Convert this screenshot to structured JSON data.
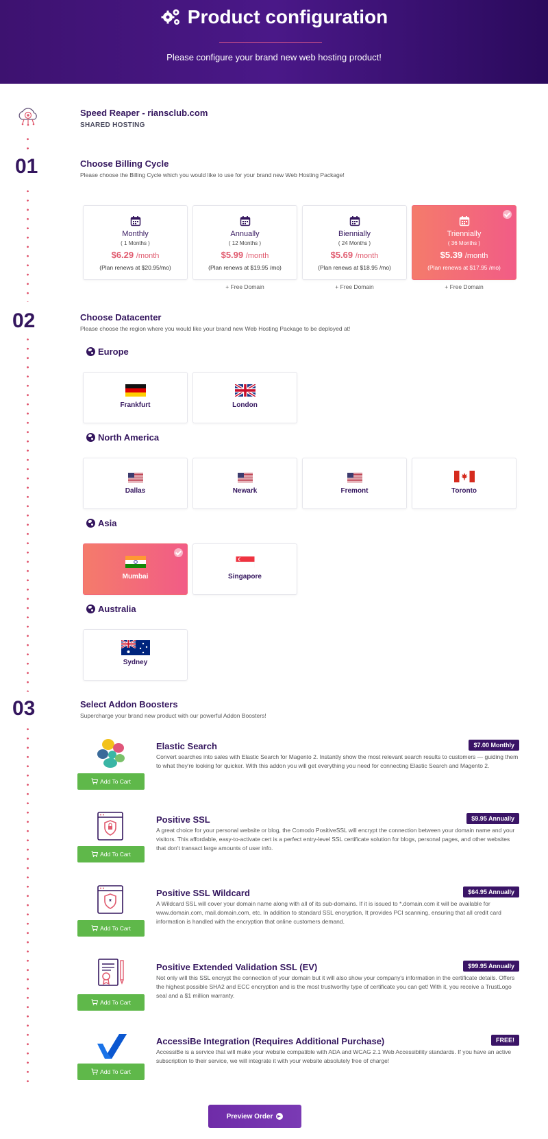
{
  "header": {
    "title": "Product configuration",
    "subtitle": "Please configure your brand new web hosting product!"
  },
  "product": {
    "name": "Speed Reaper - riansclub.com",
    "type": "SHARED HOSTING"
  },
  "steps": {
    "billing": {
      "number": "01",
      "title": "Choose Billing Cycle",
      "description": "Please choose the Billing Cycle which you would like to use for your brand new Web Hosting Package!",
      "options": [
        {
          "name": "Monthly",
          "months": "( 1 Months )",
          "price": "$6.29",
          "unit": "/month",
          "renew": "(Plan renews at $20.95/mo)",
          "extra": "",
          "selected": false
        },
        {
          "name": "Annually",
          "months": "( 12 Months )",
          "price": "$5.99",
          "unit": "/month",
          "renew": "(Plan renews at $19.95 /mo)",
          "extra": "+ Free Domain",
          "selected": false
        },
        {
          "name": "Biennially",
          "months": "( 24 Months )",
          "price": "$5.69",
          "unit": "/month",
          "renew": "(Plan renews at $18.95 /mo)",
          "extra": "+ Free Domain",
          "selected": false
        },
        {
          "name": "Triennially",
          "months": "( 36 Months )",
          "price": "$5.39",
          "unit": "/month",
          "renew": "(Plan renews at $17.95 /mo)",
          "extra": "+ Free Domain",
          "selected": true
        }
      ]
    },
    "datacenter": {
      "number": "02",
      "title": "Choose Datacenter",
      "description": "Please choose the region where you would like your brand new Web Hosting Package to be deployed at!",
      "regions": [
        {
          "name": "Europe",
          "locations": [
            {
              "name": "Frankfurt",
              "flag": "germany-flag"
            },
            {
              "name": "London",
              "flag": "uk-flag"
            }
          ]
        },
        {
          "name": "North America",
          "locations": [
            {
              "name": "Dallas",
              "flag": "us-flag"
            },
            {
              "name": "Newark",
              "flag": "us-flag"
            },
            {
              "name": "Fremont",
              "flag": "us-flag"
            },
            {
              "name": "Toronto",
              "flag": "canada-flag"
            }
          ]
        },
        {
          "name": "Asia",
          "locations": [
            {
              "name": "Mumbai",
              "flag": "india-flag",
              "selected": true
            },
            {
              "name": "Singapore",
              "flag": "singapore-flag"
            }
          ]
        },
        {
          "name": "Australia",
          "locations": [
            {
              "name": "Sydney",
              "flag": "australia-flag"
            }
          ]
        }
      ]
    },
    "addons": {
      "number": "03",
      "title": "Select Addon Boosters",
      "description": "Supercharge your brand new product with our powerful Addon Boosters!",
      "add_label": "Add To Cart",
      "items": [
        {
          "name": "Elastic Search",
          "price": "$7.00 Monthly",
          "icon": "elastic-search-icon",
          "description": "Convert searches into sales with Elastic Search for Magento 2. Instantly show the most relevant search results to customers — guiding them to what they're looking for quicker. With this addon you will get everything you need for connecting Elastic Search and Magento 2."
        },
        {
          "name": "Positive SSL",
          "price": "$9.95 Annually",
          "icon": "ssl-certificate-icon",
          "description": "A great choice for your personal website or blog, the Comodo PositiveSSL will encrypt the connection between your domain name and your visitors. This affordable, easy-to-activate cert is a perfect entry-level SSL certificate solution for blogs, personal pages, and other websites that don't transact large amounts of user info."
        },
        {
          "name": "Positive SSL Wildcard",
          "price": "$64.95 Annually",
          "icon": "ssl-wildcard-icon",
          "description": "A Wildcard SSL will cover your domain name along with all of its sub-domains. If it is issued to *.domain.com it will be available for www.domain.com, mail.domain.com, etc. In addition to standard SSL encryption, It provides PCI scanning, ensuring that all credit card information is handled with the encryption that online customers demand."
        },
        {
          "name": "Positive Extended Validation SSL (EV)",
          "price": "$99.95 Annually",
          "icon": "ev-certificate-icon",
          "description": "Not only will this SSL encrypt the connection of your domain but it will also show your company's information in the certificate details. Offers the highest possible SHA2 and ECC encryption and is the most trustworthy type of certificate you can get! With it, you receive a TrustLogo seal and a $1 million warranty."
        },
        {
          "name": "AccessiBe Integration (Requires Additional Purchase)",
          "price": "FREE!",
          "icon": "accessibe-icon",
          "description": "AccessiBe is a service that will make your website compatible with ADA and WCAG 2.1 Web Accessibility standards. If you have an active subscription to their service, we will integrate it with your website absolutely free of charge!"
        }
      ]
    }
  },
  "footer": {
    "preview_label": "Preview Order"
  },
  "colors": {
    "brand_purple": "#34165e",
    "accent_gradient_start": "#f47b6b",
    "accent_gradient_end": "#f25c86",
    "add_button": "#5fb84a"
  }
}
